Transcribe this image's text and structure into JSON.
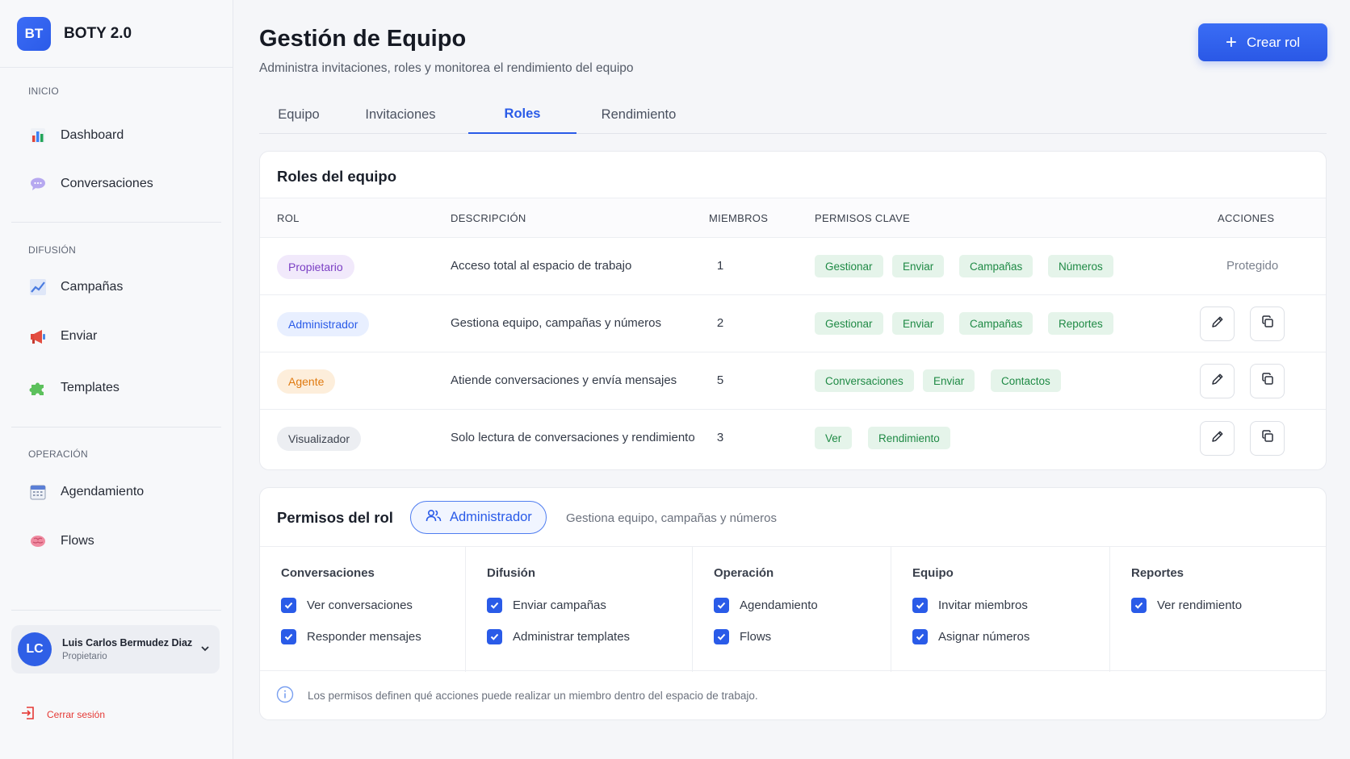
{
  "brand": {
    "logo": "BT",
    "name": "BOTY 2.0"
  },
  "sidebar": {
    "sections": [
      {
        "title": "INICIO",
        "items": [
          {
            "label": "Dashboard",
            "icon": "bar-chart-icon"
          },
          {
            "label": "Conversaciones",
            "icon": "chat-bubble-icon"
          }
        ]
      },
      {
        "title": "DIFUSIÓN",
        "items": [
          {
            "label": "Campañas",
            "icon": "line-chart-icon"
          },
          {
            "label": "Enviar",
            "icon": "megaphone-icon"
          },
          {
            "label": "Templates",
            "icon": "puzzle-icon"
          }
        ]
      },
      {
        "title": "OPERACIÓN",
        "items": [
          {
            "label": "Agendamiento",
            "icon": "calendar-icon"
          },
          {
            "label": "Flows",
            "icon": "brain-icon"
          }
        ]
      }
    ],
    "user": {
      "initials": "LC",
      "name": "Luis Carlos Bermudez Diaz",
      "role": "Propietario"
    },
    "logout": "Cerrar sesión"
  },
  "header": {
    "title": "Gestión de Equipo",
    "subtitle": "Administra invitaciones, roles y monitorea el rendimiento del equipo",
    "create_label": "Crear rol"
  },
  "tabs": [
    "Equipo",
    "Invitaciones",
    "Roles",
    "Rendimiento"
  ],
  "active_tab": "Roles",
  "roles_table": {
    "title": "Roles del equipo",
    "columns": [
      "ROL",
      "DESCRIPCIÓN",
      "MIEMBROS",
      "PERMISOS CLAVE",
      "ACCIONES"
    ],
    "rows": [
      {
        "role": "Propietario",
        "description": "Acceso total al espacio de trabajo",
        "members": "1",
        "perms": [
          "Gestionar",
          "Enviar",
          "Campañas",
          "Números"
        ],
        "action": "Protegido",
        "color": "#7b3fc4",
        "bg": "#f1e9fb"
      },
      {
        "role": "Administrador",
        "description": "Gestiona equipo, campañas y números",
        "members": "2",
        "perms": [
          "Gestionar",
          "Enviar",
          "Campañas",
          "Reportes"
        ],
        "action": "",
        "color": "#2a5be8",
        "bg": "#e8efff"
      },
      {
        "role": "Agente",
        "description": "Atiende conversaciones y envía mensajes",
        "members": "5",
        "perms": [
          "Conversaciones",
          "Enviar",
          "Contactos"
        ],
        "action": "",
        "color": "#e07a10",
        "bg": "#fdeedb"
      },
      {
        "role": "Visualizador",
        "description": "Solo lectura de conversaciones y rendimiento",
        "members": "3",
        "perms": [
          "Ver",
          "Rendimiento"
        ],
        "action": "",
        "color": "#3d434f",
        "bg": "#eceef2"
      }
    ]
  },
  "permissions": {
    "title": "Permisos del rol",
    "selected_role": "Administrador",
    "selected_desc": "Gestiona equipo, campañas y números",
    "groups": [
      {
        "title": "Conversaciones",
        "items": [
          "Ver conversaciones",
          "Responder mensajes"
        ]
      },
      {
        "title": "Difusión",
        "items": [
          "Enviar campañas",
          "Administrar templates"
        ]
      },
      {
        "title": "Operación",
        "items": [
          "Agendamiento",
          "Flows"
        ]
      },
      {
        "title": "Equipo",
        "items": [
          "Invitar miembros",
          "Asignar números"
        ]
      },
      {
        "title": "Reportes",
        "items": [
          "Ver rendimiento"
        ]
      }
    ],
    "note": "Los permisos definen qué acciones puede realizar un miembro dentro del espacio de trabajo."
  }
}
